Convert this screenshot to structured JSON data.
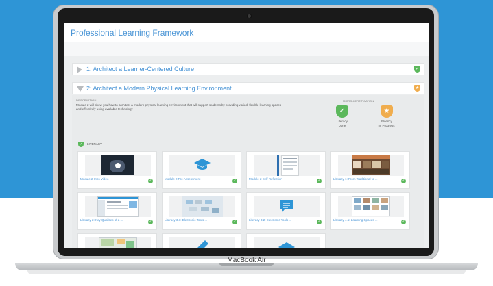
{
  "device": {
    "brand": "MacBook Air"
  },
  "page": {
    "title": "Professional Learning Framework"
  },
  "sections": [
    {
      "title": "1: Architect a Learner-Centered Culture",
      "expanded": false,
      "badge_color": "#5cb85c"
    },
    {
      "title": "2: Architect a Modern Physical Learning Environment",
      "expanded": true,
      "badge_color": "#f0ad4e"
    }
  ],
  "description": {
    "label": "DESCRIPTION",
    "text": "Module 2 will show you how to architect a modern physical learning environment that will support students by providing varied, flexible learning spaces and effectively using available technology"
  },
  "micro_certification": {
    "label": "MICRO-CERTIFICATION",
    "badges": [
      {
        "line1": "Literacy",
        "line2": "Done",
        "icon": "check-icon",
        "color": "#5cb85c"
      },
      {
        "line1": "Fluency",
        "line2": "In Progress",
        "icon": "star-icon",
        "color": "#f0ad4e"
      }
    ]
  },
  "literacy": {
    "label": "LITERACY"
  },
  "cards": [
    {
      "title": "Module 2 Intro Video",
      "thumb": "video-thumbnail"
    },
    {
      "title": "Module 2 Pre Assessment",
      "thumb": "graduation-cap-icon"
    },
    {
      "title": "Module 2 Self Reflection",
      "thumb": "document-thumbnail"
    },
    {
      "title": "Literacy 1: From Traditional to ...",
      "thumb": "classroom-photo"
    },
    {
      "title": "Literacy 2: Key Qualities of a ...",
      "thumb": "screenshot-thumbnail"
    },
    {
      "title": "Literacy 3.1: Electronic Tools ...",
      "thumb": "classroom-3d-render"
    },
    {
      "title": "Literacy 3.2: Electronic Tools ...",
      "thumb": "chat-icon"
    },
    {
      "title": "Literacy 4.1: Learning Spaces ...",
      "thumb": "photo-grid"
    },
    {
      "title": "",
      "thumb": "map-thumbnail"
    },
    {
      "title": "",
      "thumb": "pencil-icon"
    },
    {
      "title": "",
      "thumb": "shape-icon"
    }
  ]
}
